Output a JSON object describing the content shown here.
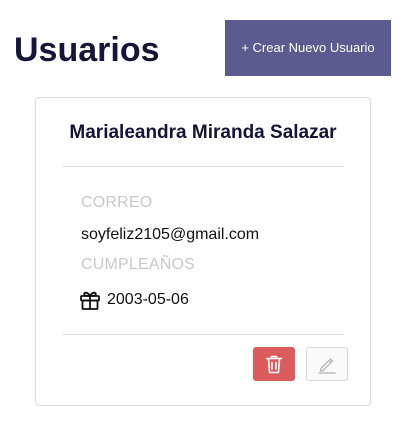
{
  "header": {
    "title": "Usuarios",
    "create_button_label": "+ Crear Nuevo Usuario"
  },
  "user_card": {
    "name": "Marialeandra Miranda Salazar",
    "email_label": "CORREO",
    "email": "soyfeliz2105@gmail.com",
    "birthday_label": "CUMPLEAÑOS",
    "birthday": "2003-05-06",
    "birthday_icon": "gift-icon",
    "delete_icon": "trash-icon",
    "edit_icon": "pencil-icon"
  },
  "colors": {
    "title": "#161638",
    "primary_button": "#5b5b8f",
    "danger_button": "#dc5b5d",
    "muted_label": "#c9c9c9"
  }
}
